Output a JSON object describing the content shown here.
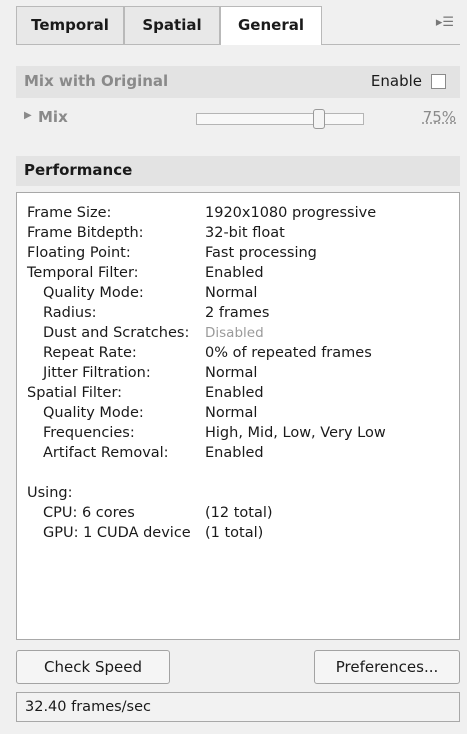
{
  "tabs": [
    {
      "label": "Temporal"
    },
    {
      "label": "Spatial"
    },
    {
      "label": "General"
    }
  ],
  "active_tab": "General",
  "menu_icon": "panel-menu-icon",
  "mix_with_original": {
    "title": "Mix with Original",
    "enable_label": "Enable",
    "enabled": false,
    "mix_label": "Mix",
    "mix_value": "75%",
    "mix_fraction": 0.75
  },
  "performance": {
    "title": "Performance",
    "rows": [
      {
        "label": "Frame Size:",
        "value": "1920x1080 progressive"
      },
      {
        "label": "Frame Bitdepth:",
        "value": "32-bit float"
      },
      {
        "label": "Floating Point:",
        "value": "Fast processing"
      },
      {
        "label": "Temporal Filter:",
        "value": "Enabled"
      },
      {
        "label": "Quality Mode:",
        "value": "Normal"
      },
      {
        "label": "Radius:",
        "value": "2 frames"
      },
      {
        "label": "Dust and Scratches:",
        "value": "Disabled"
      },
      {
        "label": "Repeat Rate:",
        "value": "0% of repeated frames"
      },
      {
        "label": "Jitter Filtration:",
        "value": "Normal"
      },
      {
        "label": "Spatial Filter:",
        "value": "Enabled"
      },
      {
        "label": "Quality Mode:",
        "value": "Normal"
      },
      {
        "label": "Frequencies:",
        "value": "High, Mid, Low, Very Low"
      },
      {
        "label": "Artifact Removal:",
        "value": "Enabled"
      }
    ],
    "using_label": "Using:",
    "using": [
      {
        "label": "CPU: 6 cores",
        "value": "(12 total)"
      },
      {
        "label": "GPU: 1 CUDA device",
        "value": "(1 total)"
      }
    ]
  },
  "buttons": {
    "check_speed": "Check Speed",
    "preferences": "Preferences..."
  },
  "status": "32.40 frames/sec"
}
